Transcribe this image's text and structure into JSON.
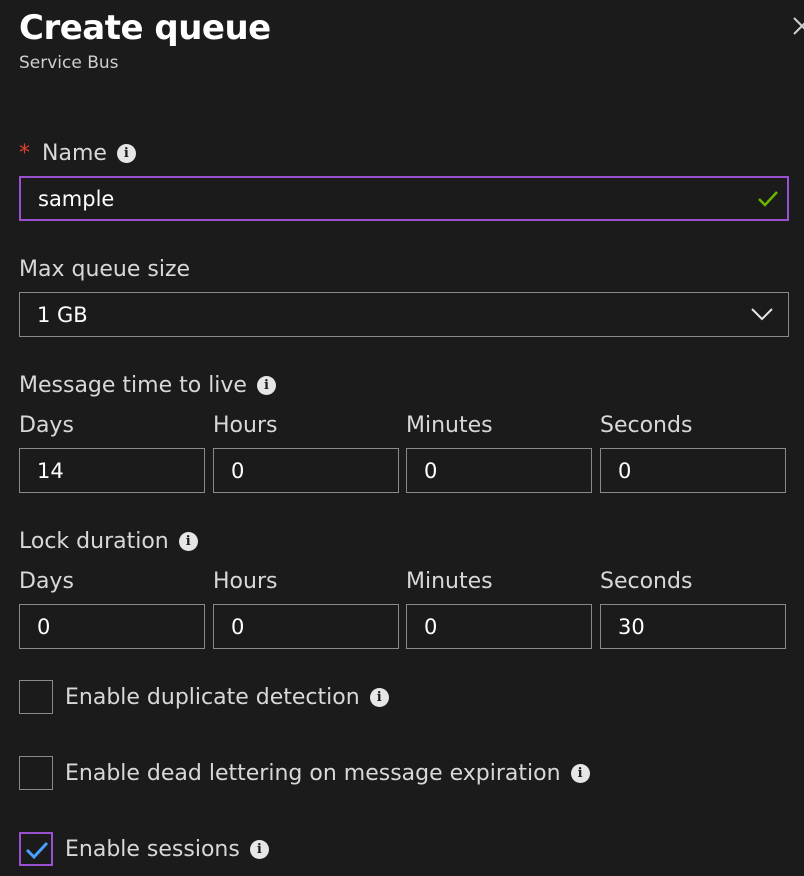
{
  "header": {
    "title": "Create queue",
    "subtitle": "Service Bus"
  },
  "name_field": {
    "label": "Name",
    "required_marker": "*",
    "value": "sample",
    "valid": true
  },
  "max_queue_size": {
    "label": "Max queue size",
    "selected": "1 GB"
  },
  "message_ttl": {
    "label": "Message time to live",
    "fields": [
      {
        "label": "Days",
        "value": "14"
      },
      {
        "label": "Hours",
        "value": "0"
      },
      {
        "label": "Minutes",
        "value": "0"
      },
      {
        "label": "Seconds",
        "value": "0"
      }
    ]
  },
  "lock_duration": {
    "label": "Lock duration",
    "fields": [
      {
        "label": "Days",
        "value": "0"
      },
      {
        "label": "Hours",
        "value": "0"
      },
      {
        "label": "Minutes",
        "value": "0"
      },
      {
        "label": "Seconds",
        "value": "30"
      }
    ]
  },
  "options": [
    {
      "label": "Enable duplicate detection",
      "checked": false
    },
    {
      "label": "Enable dead lettering on message expiration",
      "checked": false
    },
    {
      "label": "Enable sessions",
      "checked": true
    }
  ],
  "colors": {
    "background": "#1b1b1b",
    "focus_border": "#9b4fd1",
    "required": "#e0402e",
    "valid_check": "#6bb700",
    "checkbox_tick": "#4aa0ff"
  },
  "icons": {
    "info": "info-icon",
    "close": "close-icon",
    "valid": "checkmark-icon",
    "dropdown": "chevron-down-icon"
  }
}
